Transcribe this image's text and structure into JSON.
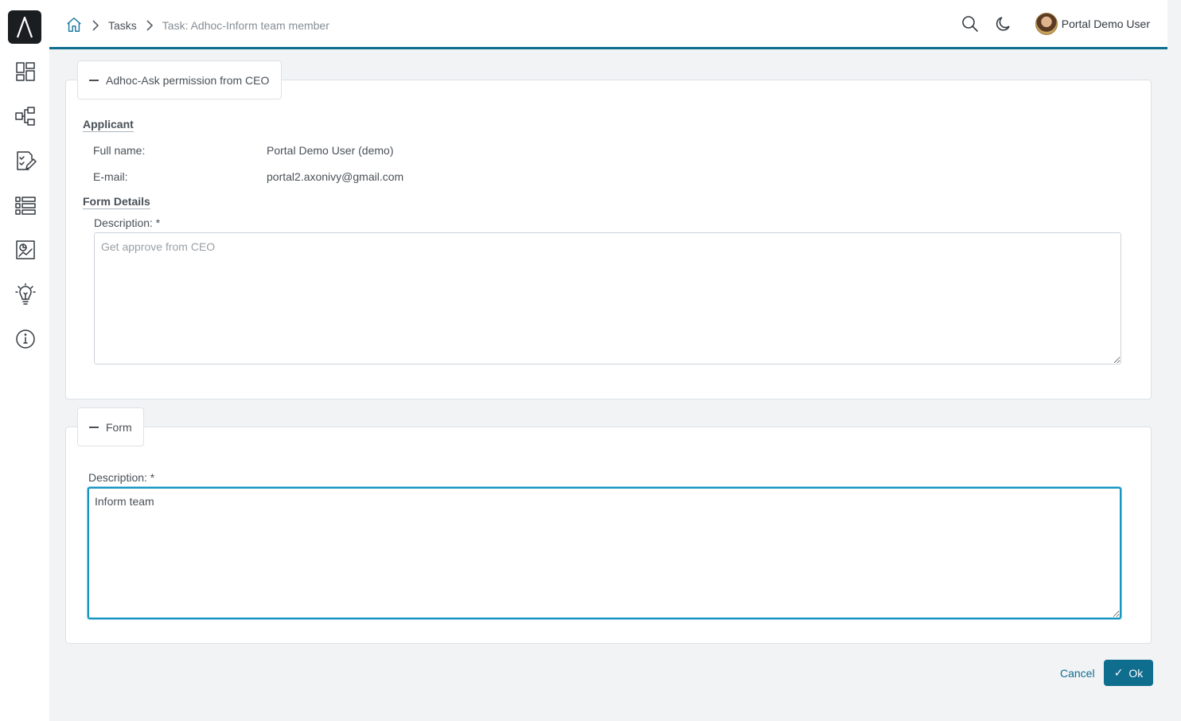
{
  "breadcrumb": {
    "tasks_label": "Tasks",
    "current_label": "Task: Adhoc-Inform team member"
  },
  "header": {
    "user_name": "Portal Demo User"
  },
  "adhoc_panel": {
    "legend": "Adhoc-Ask permission from CEO",
    "applicant_title": "Applicant",
    "full_name_label": "Full name:",
    "full_name_value": "Portal Demo User (demo)",
    "email_label": "E-mail:",
    "email_value": "portal2.axonivy@gmail.com",
    "form_details_title": "Form Details",
    "description_label": "Description: *",
    "description_value": "Get approve from CEO"
  },
  "form_panel": {
    "legend": "Form",
    "description_label": "Description: *",
    "description_value": "Inform team"
  },
  "actions": {
    "cancel_label": "Cancel",
    "ok_label": "Ok"
  },
  "colors": {
    "accent": "#0f6d8e",
    "focus": "#1a93c0"
  }
}
